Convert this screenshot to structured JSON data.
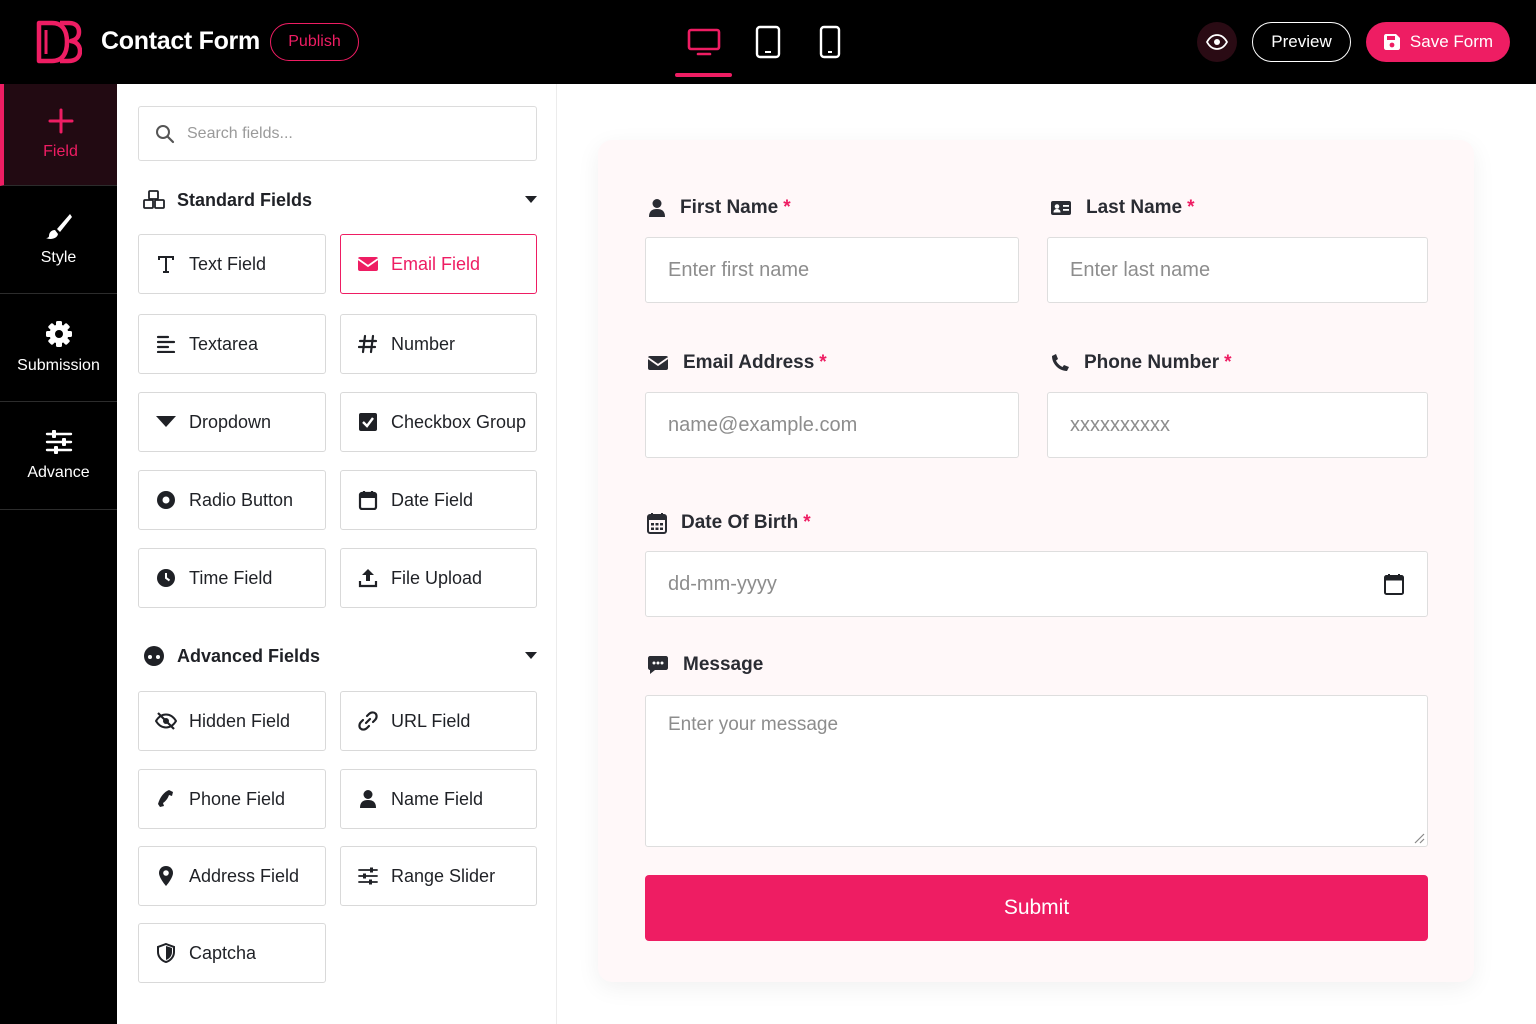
{
  "app": {
    "title": "Contact Form",
    "publish_label": "Publish"
  },
  "topbar": {
    "devices": [
      "desktop-icon",
      "tablet-icon",
      "mobile-icon"
    ],
    "active_device": "desktop",
    "preview_label": "Preview",
    "save_label": "Save Form"
  },
  "rail": {
    "items": [
      {
        "label": "Field",
        "icon": "plus-icon",
        "active": true
      },
      {
        "label": "Style",
        "icon": "brush-icon",
        "active": false
      },
      {
        "label": "Submission",
        "icon": "gear-icon",
        "active": false
      },
      {
        "label": "Advance",
        "icon": "sliders-icon",
        "active": false
      }
    ]
  },
  "panel": {
    "search_placeholder": "Search fields...",
    "standard": {
      "title": "Standard Fields",
      "fields": [
        "Text Field",
        "Email Field",
        "Textarea",
        "Number",
        "Dropdown",
        "Checkbox Group",
        "Radio Button",
        "Date Field",
        "Time Field",
        "File Upload"
      ],
      "selected": "Email Field"
    },
    "advanced": {
      "title": "Advanced Fields",
      "fields": [
        "Hidden Field",
        "URL Field",
        "Phone Field",
        "Name Field",
        "Address Field",
        "Range Slider",
        "Captcha"
      ]
    }
  },
  "form": {
    "first_name": {
      "label": "First Name",
      "required": "*",
      "placeholder": "Enter first name"
    },
    "last_name": {
      "label": "Last Name",
      "required": "*",
      "placeholder": "Enter last name"
    },
    "email": {
      "label": "Email Address",
      "required": "*",
      "placeholder": "name@example.com"
    },
    "phone": {
      "label": "Phone Number",
      "required": "*",
      "placeholder": "xxxxxxxxxx"
    },
    "dob": {
      "label": "Date Of Birth",
      "required": "*",
      "placeholder": "dd-mm-yyyy"
    },
    "message": {
      "label": "Message",
      "placeholder": "Enter your message"
    },
    "submit_label": "Submit"
  },
  "colors": {
    "accent": "#ee1d63",
    "topbar": "#000000",
    "card": "#fff8f9"
  }
}
